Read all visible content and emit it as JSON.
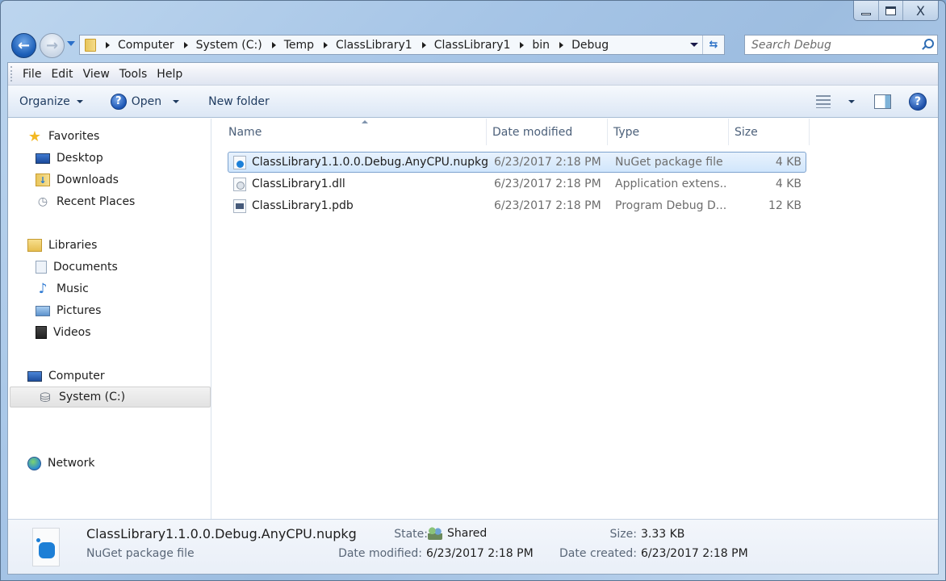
{
  "window": {
    "caption_buttons": {
      "minimize": "minimize",
      "maximize": "maximize",
      "close": "X"
    }
  },
  "nav": {
    "back_label": "←",
    "forward_label": "→",
    "breadcrumb": [
      "Computer",
      "System (C:)",
      "Temp",
      "ClassLibrary1",
      "ClassLibrary1",
      "bin",
      "Debug"
    ],
    "refresh_glyph": "⇆",
    "search_placeholder": "Search Debug"
  },
  "menubar": [
    "File",
    "Edit",
    "View",
    "Tools",
    "Help"
  ],
  "toolbar": {
    "organize": "Organize",
    "open": "Open",
    "new_folder": "New folder",
    "help_glyph": "?"
  },
  "navpane": {
    "favorites": {
      "label": "Favorites",
      "children": [
        "Desktop",
        "Downloads",
        "Recent Places"
      ]
    },
    "libraries": {
      "label": "Libraries",
      "children": [
        "Documents",
        "Music",
        "Pictures",
        "Videos"
      ]
    },
    "computer": {
      "label": "Computer",
      "children": [
        "System (C:)"
      ],
      "selected": "System (C:)"
    },
    "network": {
      "label": "Network"
    }
  },
  "filelist": {
    "columns": [
      "Name",
      "Date modified",
      "Type",
      "Size"
    ],
    "sort_column": "Name",
    "rows": [
      {
        "name": "ClassLibrary1.1.0.0.Debug.AnyCPU.nupkg",
        "date": "6/23/2017 2:18 PM",
        "type": "NuGet package file",
        "size": "4 KB",
        "icon": "nupkg-icon",
        "selected": true
      },
      {
        "name": "ClassLibrary1.dll",
        "date": "6/23/2017 2:18 PM",
        "type": "Application extens...",
        "size": "4 KB",
        "icon": "dll-icon",
        "selected": false
      },
      {
        "name": "ClassLibrary1.pdb",
        "date": "6/23/2017 2:18 PM",
        "type": "Program Debug D...",
        "size": "12 KB",
        "icon": "pdb-icon",
        "selected": false
      }
    ]
  },
  "details": {
    "filename": "ClassLibrary1.1.0.0.Debug.AnyCPU.nupkg",
    "filetype": "NuGet package file",
    "state_label": "State:",
    "state_value": "Shared",
    "size_label": "Size:",
    "size_value": "3.33 KB",
    "modified_label": "Date modified:",
    "modified_value": "6/23/2017 2:18 PM",
    "created_label": "Date created:",
    "created_value": "6/23/2017 2:18 PM"
  },
  "colors": {
    "selection_fill": "#d1e6fc",
    "selection_border": "#7da2ce",
    "frame": "#a5c4e6"
  }
}
